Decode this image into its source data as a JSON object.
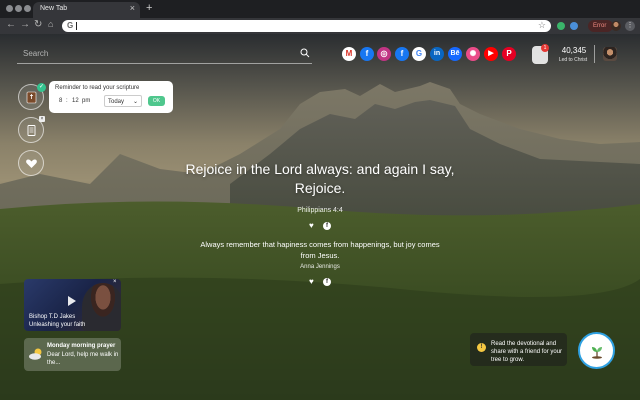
{
  "browser": {
    "tab_title": "New Tab",
    "tab_close": "×",
    "new_tab": "+",
    "omnibox_value": "",
    "omnibox_g": "G",
    "error_label": "Error",
    "menu": "⋮"
  },
  "search": {
    "placeholder": "Search"
  },
  "social_icons": [
    "gmail",
    "facebook",
    "instagram",
    "facebook",
    "google",
    "linkedin",
    "behance",
    "dribbble",
    "youtube",
    "pinterest"
  ],
  "stats": {
    "notification_count": "1",
    "count": "40,345",
    "count_label": "Led to Christ"
  },
  "reminder": {
    "title": "Reminder to read your scripture",
    "hour": "8",
    "minute": "12",
    "period": "pm",
    "day": "Today",
    "ok_label": "OK"
  },
  "verse": {
    "text": "Rejoice in the Lord always: and again I say, Rejoice.",
    "reference": "Philippians 4:4"
  },
  "secondary_quote": {
    "text": "Always remember that hapiness comes from happenings, but joy comes from Jesus.",
    "author": "Anna Jennings"
  },
  "video": {
    "title_line1": "Bishop T.D Jakes",
    "title_line2": "Unleashing your faith",
    "close": "×"
  },
  "prayer": {
    "title": "Monday morning prayer",
    "text": "Dear Lord, help me walk in the..."
  },
  "tree": {
    "warning": "!",
    "text": "Read the devotional and share with a friend for your tree to grow."
  },
  "colors": {
    "accent_green": "#4fc78d",
    "tree_ring": "#2fa1e2",
    "badge_red": "#e53935"
  }
}
